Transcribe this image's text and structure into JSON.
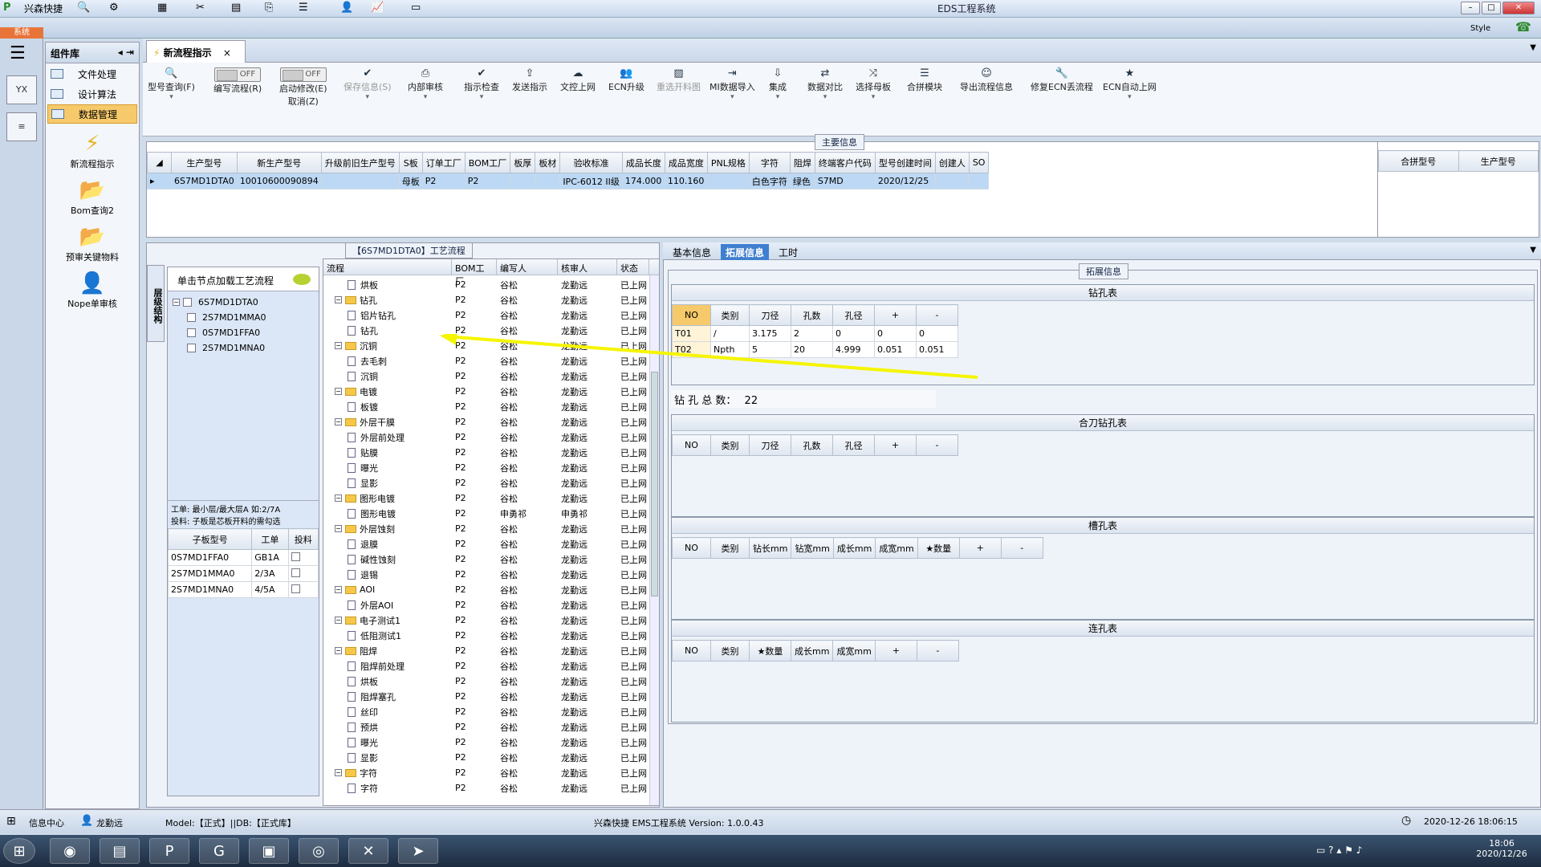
{
  "window": {
    "app_name": "兴森快捷",
    "title": "EDS工程系统",
    "style_label": "Style"
  },
  "sys_tab": "系统",
  "left_icons": [
    "YX",
    "≡"
  ],
  "component_lib": {
    "title": "组件库",
    "items": [
      {
        "label": "文件处理",
        "selected": false
      },
      {
        "label": "设计算法",
        "selected": false
      },
      {
        "label": "数据管理",
        "selected": true
      }
    ],
    "big_items": [
      "新流程指示",
      "Bom查询2",
      "预审关键物料",
      "Nope单审核"
    ]
  },
  "doc_tab": {
    "label": "新流程指示",
    "close": "×"
  },
  "toolbar": {
    "items": [
      {
        "label": "型号查询(F)",
        "icon": "search-icon",
        "dropdown": true,
        "disabled": false
      },
      {
        "label": "编写流程(R)",
        "toggle": "OFF",
        "disabled": false
      },
      {
        "label": "启动修改(E)",
        "sub": "取消(Z)",
        "toggle": "OFF",
        "disabled": false
      },
      {
        "label": "保存信息(S)",
        "icon": "check-icon",
        "dropdown": true,
        "disabled": true
      },
      {
        "label": "内部审核",
        "icon": "print-icon",
        "dropdown": true,
        "disabled": false
      },
      {
        "label": "指示检查",
        "icon": "check-icon",
        "dropdown": true,
        "disabled": false
      },
      {
        "label": "发送指示",
        "icon": "upload-icon",
        "dropdown": false,
        "disabled": false
      },
      {
        "label": "文控上网",
        "icon": "cloud-upload-icon",
        "dropdown": false,
        "disabled": false
      },
      {
        "label": "ECN升级",
        "icon": "people-icon",
        "dropdown": false,
        "disabled": false
      },
      {
        "label": "重选开料图",
        "icon": "image-icon",
        "dropdown": false,
        "disabled": true
      },
      {
        "label": "MI数据导入",
        "icon": "import-icon",
        "dropdown": true,
        "disabled": false
      },
      {
        "label": "集成",
        "icon": "download-icon",
        "dropdown": true,
        "disabled": false
      },
      {
        "label": "数据对比",
        "icon": "compare-icon",
        "dropdown": true,
        "disabled": false
      },
      {
        "label": "选择母板",
        "icon": "shuffle-icon",
        "dropdown": true,
        "disabled": false
      },
      {
        "label": "合拼模块",
        "icon": "list-icon",
        "dropdown": false,
        "disabled": false
      },
      {
        "label": "导出流程信息",
        "icon": "smile-icon",
        "dropdown": false,
        "disabled": false
      },
      {
        "label": "修复ECN丢流程",
        "icon": "wrench-icon",
        "dropdown": false,
        "disabled": false
      },
      {
        "label": "ECN自动上网",
        "icon": "star-icon",
        "dropdown": true,
        "disabled": false
      }
    ]
  },
  "main_info": {
    "title": "主要信息",
    "headers": [
      "生产型号",
      "新生产型号",
      "升级前旧生产型号",
      "S板",
      "订单工厂",
      "BOM工厂",
      "板厚",
      "板材",
      "验收标准",
      "成品长度",
      "成品宽度",
      "PNL规格",
      "字符",
      "阻焊",
      "终端客户代码",
      "型号创建时间",
      "创建人",
      "SO"
    ],
    "row": [
      "6S7MD1DTA0",
      "10010600090894",
      "",
      "母板",
      "P2",
      "P2",
      "",
      "",
      "IPC-6012 II级",
      "174.000",
      "110.160",
      "",
      "白色字符",
      "绿色",
      "S7MD",
      "2020/12/25",
      "",
      ""
    ],
    "side_headers": [
      "合拼型号",
      "生产型号"
    ]
  },
  "process_panel": {
    "title": "【6S7MD1DTA0】工艺流程",
    "vertical_tab": "层级结构",
    "load_hint": "单击节点加载工艺流程",
    "tree": [
      {
        "label": "6S7MD1DTA0",
        "level": 0
      },
      {
        "label": "2S7MD1MMA0",
        "level": 1
      },
      {
        "label": "0S7MD1FFA0",
        "level": 1
      },
      {
        "label": "2S7MD1MNA0",
        "level": 1
      }
    ],
    "note_line1": "工单: 最小层/最大层A 如:2/7A",
    "note_line2": "投料: 子板是芯板开料的需勾选",
    "sub_headers": [
      "子板型号",
      "工单",
      "投料"
    ],
    "sub_rows": [
      [
        "0S7MD1FFA0",
        "GB1A"
      ],
      [
        "2S7MD1MMA0",
        "2/3A"
      ],
      [
        "2S7MD1MNA0",
        "4/5A"
      ]
    ],
    "flow_headers": [
      "流程",
      "BOM工厂",
      "编写人",
      "核审人",
      "状态"
    ],
    "flow_rows": [
      {
        "name": "烘板",
        "type": "doc",
        "depth": 1,
        "factory": "P2",
        "writer": "谷松",
        "reviewer": "龙勤远",
        "status": "已上网"
      },
      {
        "name": "钻孔",
        "type": "folder",
        "depth": 0,
        "factory": "P2",
        "writer": "谷松",
        "reviewer": "龙勤远",
        "status": "已上网"
      },
      {
        "name": "铝片钻孔",
        "type": "doc",
        "depth": 1,
        "factory": "P2",
        "writer": "谷松",
        "reviewer": "龙勤远",
        "status": "已上网"
      },
      {
        "name": "钻孔",
        "type": "doc",
        "depth": 1,
        "factory": "P2",
        "writer": "谷松",
        "reviewer": "龙勤远",
        "status": "已上网"
      },
      {
        "name": "沉铜",
        "type": "folder",
        "depth": 0,
        "factory": "P2",
        "writer": "谷松",
        "reviewer": "龙勤远",
        "status": "已上网"
      },
      {
        "name": "去毛刺",
        "type": "doc",
        "depth": 1,
        "factory": "P2",
        "writer": "谷松",
        "reviewer": "龙勤远",
        "status": "已上网"
      },
      {
        "name": "沉铜",
        "type": "doc",
        "depth": 1,
        "factory": "P2",
        "writer": "谷松",
        "reviewer": "龙勤远",
        "status": "已上网"
      },
      {
        "name": "电镀",
        "type": "folder",
        "depth": 0,
        "factory": "P2",
        "writer": "谷松",
        "reviewer": "龙勤远",
        "status": "已上网"
      },
      {
        "name": "板镀",
        "type": "doc",
        "depth": 1,
        "factory": "P2",
        "writer": "谷松",
        "reviewer": "龙勤远",
        "status": "已上网"
      },
      {
        "name": "外层干膜",
        "type": "folder",
        "depth": 0,
        "factory": "P2",
        "writer": "谷松",
        "reviewer": "龙勤远",
        "status": "已上网"
      },
      {
        "name": "外层前处理",
        "type": "doc",
        "depth": 1,
        "factory": "P2",
        "writer": "谷松",
        "reviewer": "龙勤远",
        "status": "已上网"
      },
      {
        "name": "贴膜",
        "type": "doc",
        "depth": 1,
        "factory": "P2",
        "writer": "谷松",
        "reviewer": "龙勤远",
        "status": "已上网"
      },
      {
        "name": "曝光",
        "type": "doc",
        "depth": 1,
        "factory": "P2",
        "writer": "谷松",
        "reviewer": "龙勤远",
        "status": "已上网"
      },
      {
        "name": "显影",
        "type": "doc",
        "depth": 1,
        "factory": "P2",
        "writer": "谷松",
        "reviewer": "龙勤远",
        "status": "已上网"
      },
      {
        "name": "图形电镀",
        "type": "folder",
        "depth": 0,
        "factory": "P2",
        "writer": "谷松",
        "reviewer": "龙勤远",
        "status": "已上网"
      },
      {
        "name": "图形电镀",
        "type": "doc",
        "depth": 1,
        "factory": "P2",
        "writer": "申勇祁",
        "reviewer": "申勇祁",
        "status": "已上网"
      },
      {
        "name": "外层蚀刻",
        "type": "folder",
        "depth": 0,
        "factory": "P2",
        "writer": "谷松",
        "reviewer": "龙勤远",
        "status": "已上网"
      },
      {
        "name": "退膜",
        "type": "doc",
        "depth": 1,
        "factory": "P2",
        "writer": "谷松",
        "reviewer": "龙勤远",
        "status": "已上网"
      },
      {
        "name": "碱性蚀刻",
        "type": "doc",
        "depth": 1,
        "factory": "P2",
        "writer": "谷松",
        "reviewer": "龙勤远",
        "status": "已上网"
      },
      {
        "name": "退锡",
        "type": "doc",
        "depth": 1,
        "factory": "P2",
        "writer": "谷松",
        "reviewer": "龙勤远",
        "status": "已上网"
      },
      {
        "name": "AOI",
        "type": "folder",
        "depth": 0,
        "factory": "P2",
        "writer": "谷松",
        "reviewer": "龙勤远",
        "status": "已上网"
      },
      {
        "name": "外层AOI",
        "type": "doc",
        "depth": 1,
        "factory": "P2",
        "writer": "谷松",
        "reviewer": "龙勤远",
        "status": "已上网"
      },
      {
        "name": "电子测试1",
        "type": "folder",
        "depth": 0,
        "factory": "P2",
        "writer": "谷松",
        "reviewer": "龙勤远",
        "status": "已上网"
      },
      {
        "name": "低阻测试1",
        "type": "doc",
        "depth": 1,
        "factory": "P2",
        "writer": "谷松",
        "reviewer": "龙勤远",
        "status": "已上网"
      },
      {
        "name": "阻焊",
        "type": "folder",
        "depth": 0,
        "factory": "P2",
        "writer": "谷松",
        "reviewer": "龙勤远",
        "status": "已上网"
      },
      {
        "name": "阻焊前处理",
        "type": "doc",
        "depth": 1,
        "factory": "P2",
        "writer": "谷松",
        "reviewer": "龙勤远",
        "status": "已上网"
      },
      {
        "name": "烘板",
        "type": "doc",
        "depth": 1,
        "factory": "P2",
        "writer": "谷松",
        "reviewer": "龙勤远",
        "status": "已上网"
      },
      {
        "name": "阻焊塞孔",
        "type": "doc",
        "depth": 1,
        "factory": "P2",
        "writer": "谷松",
        "reviewer": "龙勤远",
        "status": "已上网"
      },
      {
        "name": "丝印",
        "type": "doc",
        "depth": 1,
        "factory": "P2",
        "writer": "谷松",
        "reviewer": "龙勤远",
        "status": "已上网"
      },
      {
        "name": "预烘",
        "type": "doc",
        "depth": 1,
        "factory": "P2",
        "writer": "谷松",
        "reviewer": "龙勤远",
        "status": "已上网"
      },
      {
        "name": "曝光",
        "type": "doc",
        "depth": 1,
        "factory": "P2",
        "writer": "谷松",
        "reviewer": "龙勤远",
        "status": "已上网"
      },
      {
        "name": "显影",
        "type": "doc",
        "depth": 1,
        "factory": "P2",
        "writer": "谷松",
        "reviewer": "龙勤远",
        "status": "已上网"
      },
      {
        "name": "字符",
        "type": "folder",
        "depth": 0,
        "factory": "P2",
        "writer": "谷松",
        "reviewer": "龙勤远",
        "status": "已上网"
      },
      {
        "name": "字符",
        "type": "doc",
        "depth": 1,
        "factory": "P2",
        "writer": "谷松",
        "reviewer": "龙勤远",
        "status": "已上网"
      }
    ]
  },
  "right_panel": {
    "tabs": [
      {
        "label": "基本信息",
        "active": false
      },
      {
        "label": "拓展信息",
        "active": true
      },
      {
        "label": "工时",
        "active": false
      }
    ],
    "group_title": "拓展信息",
    "drill": {
      "title": "钻孔表",
      "headers": [
        "NO",
        "类别",
        "刀径",
        "孔数",
        "孔径",
        "+",
        "-"
      ],
      "rows": [
        [
          "T01",
          "/",
          "3.175",
          "2",
          "0",
          "0",
          "0"
        ],
        [
          "T02",
          "Npth",
          "5",
          "20",
          "4.999",
          "0.051",
          "0.051"
        ]
      ],
      "total_label": "钻 孔 总 数：",
      "total_value": "22"
    },
    "combine": {
      "title": "合刀钻孔表",
      "headers": [
        "NO",
        "类别",
        "刀径",
        "孔数",
        "孔径",
        "+",
        "-"
      ]
    },
    "slot": {
      "title": "槽孔表",
      "headers": [
        "NO",
        "类别",
        "钻长mm",
        "钻宽mm",
        "成长mm",
        "成宽mm",
        "★数量",
        "+",
        "-"
      ]
    },
    "link": {
      "title": "连孔表",
      "headers": [
        "NO",
        "类别",
        "★数量",
        "成长mm",
        "成宽mm",
        "+",
        "-"
      ]
    }
  },
  "status_bar": {
    "info_center": "信息中心",
    "user": "龙勤远",
    "model": "Model:【正式】||DB:【正式库】",
    "version": "兴森快捷 EMS工程系统 Version: 1.0.0.43",
    "datetime": "2020-12-26 18:06:15"
  },
  "taskbar": {
    "time": "18:06",
    "date": "2020/12/26"
  },
  "colors": {
    "accent": "#3f7fd0",
    "selection": "#bcd8f4",
    "arrow": "#f5f500"
  }
}
